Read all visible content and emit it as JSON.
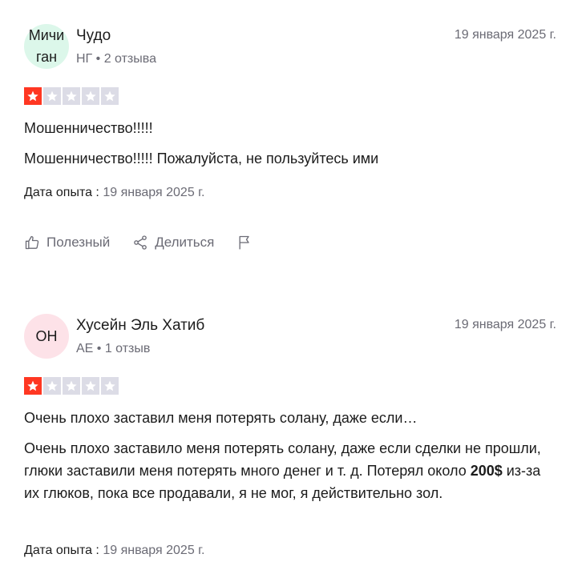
{
  "reviews": [
    {
      "avatar_text": "Мичи ган",
      "name": "Чудо",
      "meta": "НГ • 2 отзыва",
      "date": "19 января 2025 г.",
      "rating": 1,
      "title": "Мошенничество!!!!!",
      "body": "Мошенничество!!!!! Пожалуйста, не пользуйтесь ими",
      "experience_label": "Дата опыта :",
      "experience_date": "19 января 2025 г.",
      "useful_label": "Полезный",
      "share_label": "Делиться"
    },
    {
      "avatar_text": "ОН",
      "name": "Хусейн Эль Хатиб",
      "meta": "AE • 1 отзыв",
      "date": "19 января 2025 г.",
      "rating": 1,
      "title": "Очень плохо заставил меня потерять солану, даже если…",
      "body_pre": "Очень плохо заставило меня потерять солану, даже если сделки не прошли, глюки заставили меня потерять много денег и т. д. Потерял около ",
      "body_bold": "200$",
      "body_post": " из-за их глюков, пока все продавали, я не мог, я действительно зол.",
      "experience_label": "Дата опыта :",
      "experience_date": "19 января 2025 г."
    }
  ],
  "colors": {
    "star_on": "#ff3722",
    "star_off": "#dcdce6",
    "muted": "#6b6b75"
  },
  "icons": [
    "star-icon",
    "thumbs-up-icon",
    "share-icon",
    "flag-icon"
  ]
}
